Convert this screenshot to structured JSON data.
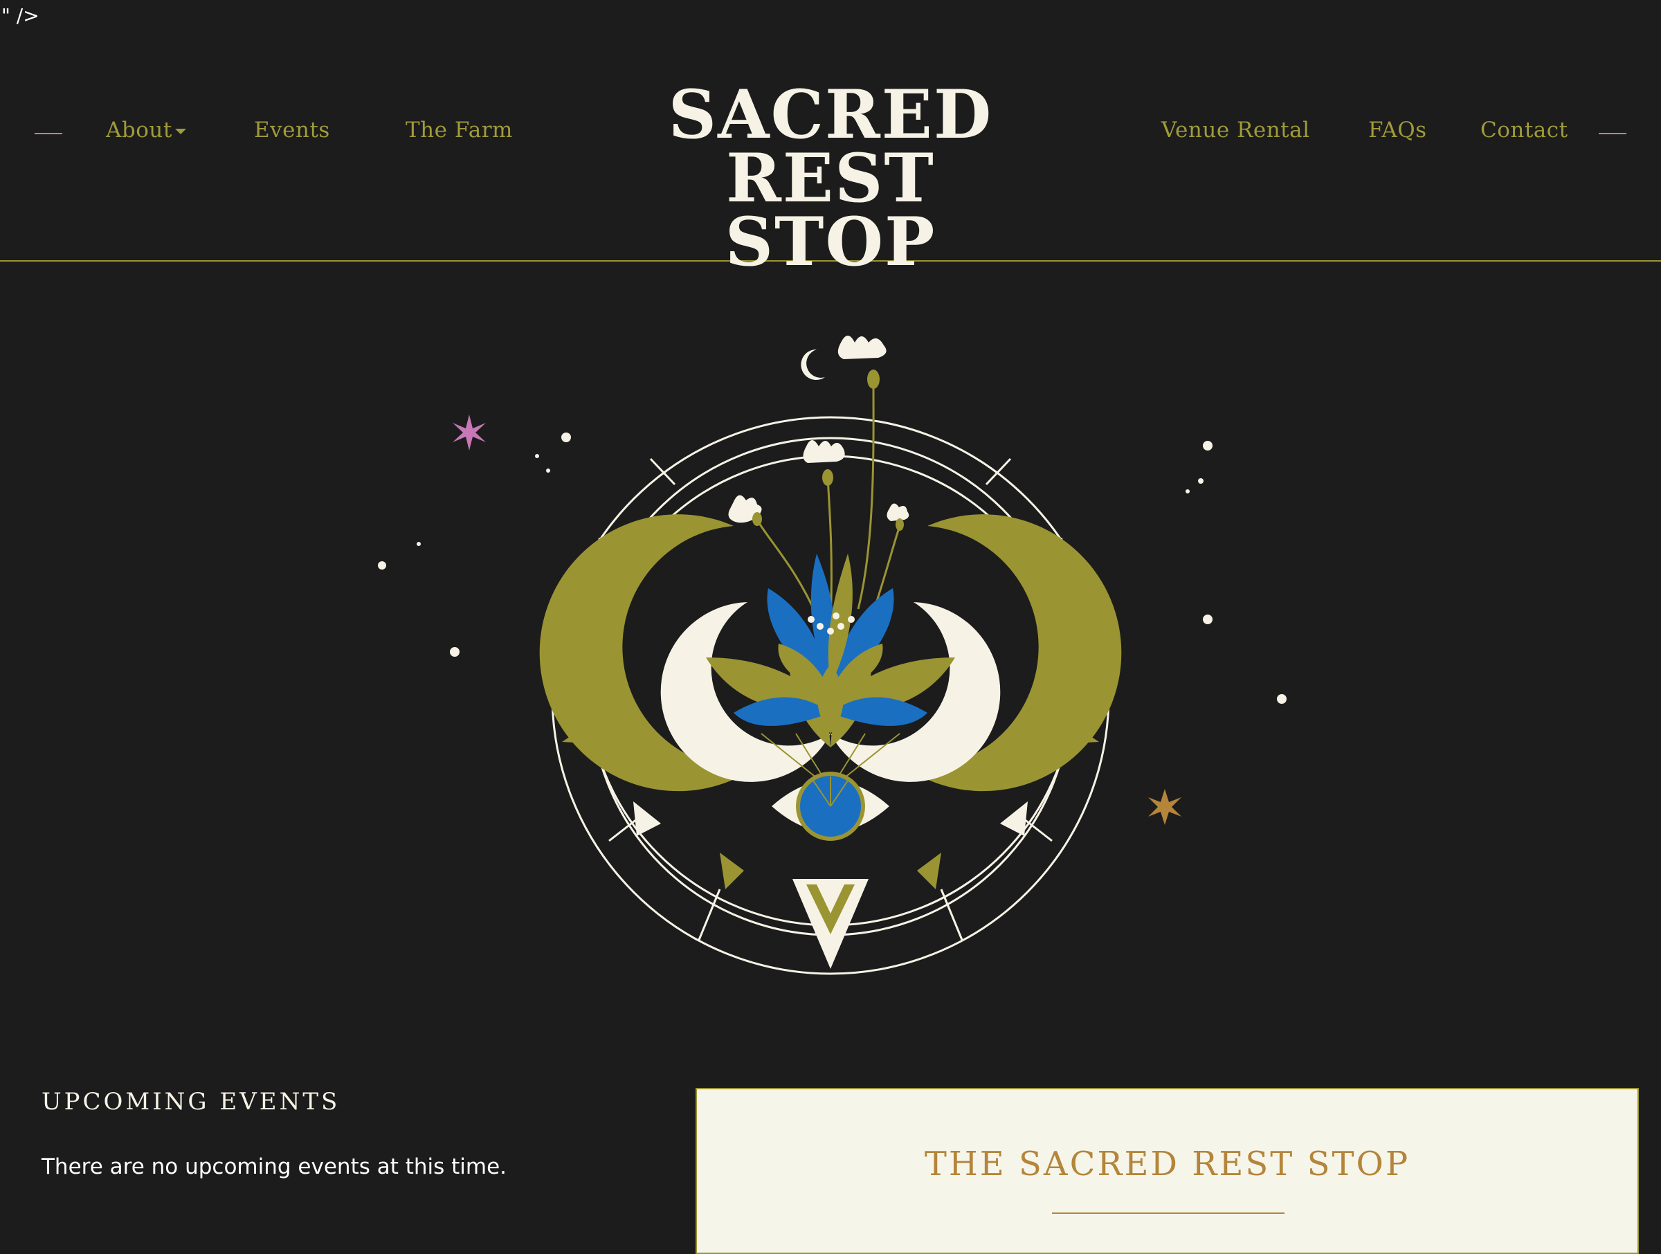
{
  "stray_markup": "\" />",
  "header": {
    "logo_line1": "SACRED",
    "logo_line2": "REST STOP",
    "nav_left": [
      {
        "label": "About",
        "has_dropdown": true
      },
      {
        "label": "Events"
      },
      {
        "label": "The Farm"
      }
    ],
    "nav_right": [
      {
        "label": "Venue Rental"
      },
      {
        "label": "FAQs"
      },
      {
        "label": "Contact"
      }
    ]
  },
  "hero": {
    "illustration": "mystic-lotus-moon-eye-emblem"
  },
  "events": {
    "heading": "UPCOMING EVENTS",
    "empty_message": "There are no upcoming events at this time."
  },
  "card": {
    "title": "THE SACRED REST STOP"
  },
  "colors": {
    "background": "#1c1c1c",
    "olive": "#9a9433",
    "cream": "#f6f3e6",
    "blue": "#1a6fc0",
    "pink": "#c877b7",
    "copper": "#b4853a"
  }
}
